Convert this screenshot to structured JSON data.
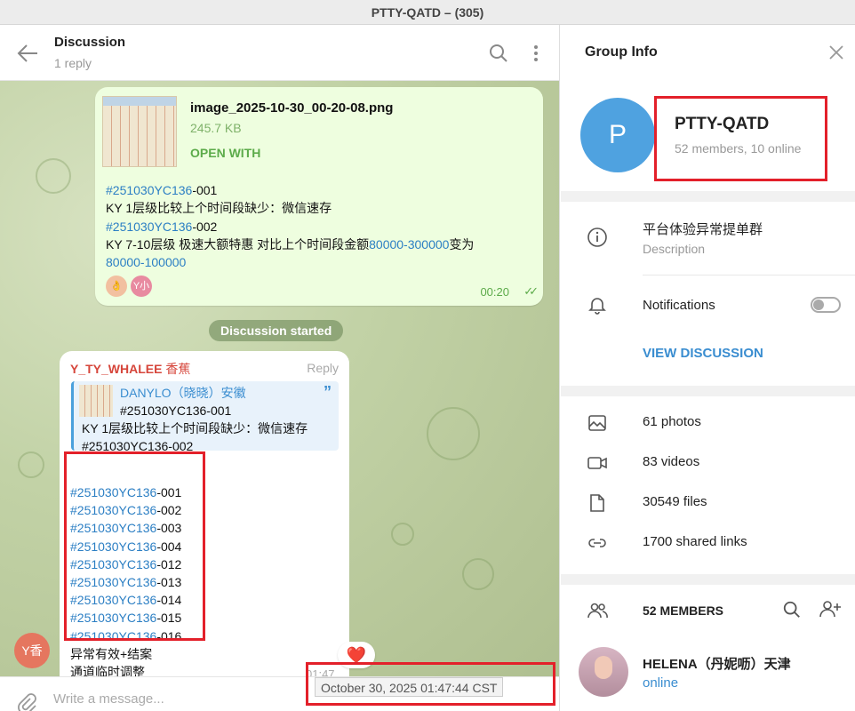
{
  "window": {
    "title": "PTTY-QATD – (305)"
  },
  "chat": {
    "header": {
      "title": "Discussion",
      "subtitle": "1 reply"
    },
    "file_message": {
      "filename": "image_2025-10-30_00-20-08.png",
      "size": "245.7 KB",
      "open_with": "OPEN WITH",
      "lines": [
        [
          {
            "text": "#251030YC136",
            "tag": true
          },
          {
            "text": "-001"
          }
        ],
        [
          {
            "text": "KY 1层级比较上个时间段缺少：微信速存"
          }
        ],
        [
          {
            "text": "#251030YC136",
            "tag": true
          },
          {
            "text": "-002"
          }
        ],
        [
          {
            "text": "KY 7-10层级 极速大额特惠 对比上个时间段金额"
          },
          {
            "text": "80000-300000",
            "tag": true
          },
          {
            "text": "变为"
          }
        ],
        [
          {
            "text": "80000-100000",
            "tag": true
          }
        ]
      ],
      "reactions": [
        {
          "label": "👌",
          "color": "#f2c0a0"
        },
        {
          "label": "Y小",
          "color": "#e88aa0"
        }
      ],
      "time": "00:20",
      "read_mark": "✓✓"
    },
    "service_message": "Discussion started",
    "reply_message": {
      "sender": "Y_TY_WHALEE",
      "sender_nick": "香蕉",
      "reply_label": "Reply",
      "quote": {
        "author": "DANYLO（晓晓）安徽",
        "mark": "”",
        "line1": "#251030YC136-001",
        "line2": "KY 1层级比较上个时间段缺少：微信速存",
        "line3": "#251030YC136-002"
      },
      "lines": [
        [
          {
            "text": "#251030YC136",
            "tag": true
          },
          {
            "text": "-001"
          }
        ],
        [
          {
            "text": "#251030YC136",
            "tag": true
          },
          {
            "text": "-002"
          }
        ],
        [
          {
            "text": "#251030YC136",
            "tag": true
          },
          {
            "text": "-003"
          }
        ],
        [
          {
            "text": "#251030YC136",
            "tag": true
          },
          {
            "text": "-004"
          }
        ],
        [
          {
            "text": "#251030YC136",
            "tag": true
          },
          {
            "text": "-012"
          }
        ],
        [
          {
            "text": "#251030YC136",
            "tag": true
          },
          {
            "text": "-013"
          }
        ],
        [
          {
            "text": "#251030YC136",
            "tag": true
          },
          {
            "text": "-014"
          }
        ],
        [
          {
            "text": "#251030YC136",
            "tag": true
          },
          {
            "text": "-015"
          }
        ],
        [
          {
            "text": "#251030YC136",
            "tag": true
          },
          {
            "text": "-016"
          }
        ],
        [
          {
            "text": "异常有效+结案"
          }
        ],
        [
          {
            "text": "通道临时调整"
          }
        ]
      ],
      "time": "01:47",
      "reaction": "❤️",
      "avatar_initials": "Y香"
    },
    "date_tooltip": "October 30, 2025 01:47:44 CST",
    "compose": {
      "placeholder": "Write a message..."
    }
  },
  "group_info": {
    "title": "Group Info",
    "avatar_letter": "P",
    "name": "PTTY-QATD",
    "meta": "52 members, 10 online",
    "description": "平台体验异常提单群",
    "description_label": "Description",
    "notifications_label": "Notifications",
    "notifications_on": false,
    "view_discussion": "VIEW DISCUSSION",
    "media": [
      {
        "icon": "photo-icon",
        "label": "61 photos"
      },
      {
        "icon": "video-icon",
        "label": "83 videos"
      },
      {
        "icon": "file-icon",
        "label": "30549 files"
      },
      {
        "icon": "link-icon",
        "label": "1700 shared links"
      }
    ],
    "members_header": "52 MEMBERS",
    "member": {
      "name": "HELENA（丹妮呖）天津",
      "status": "online"
    }
  }
}
